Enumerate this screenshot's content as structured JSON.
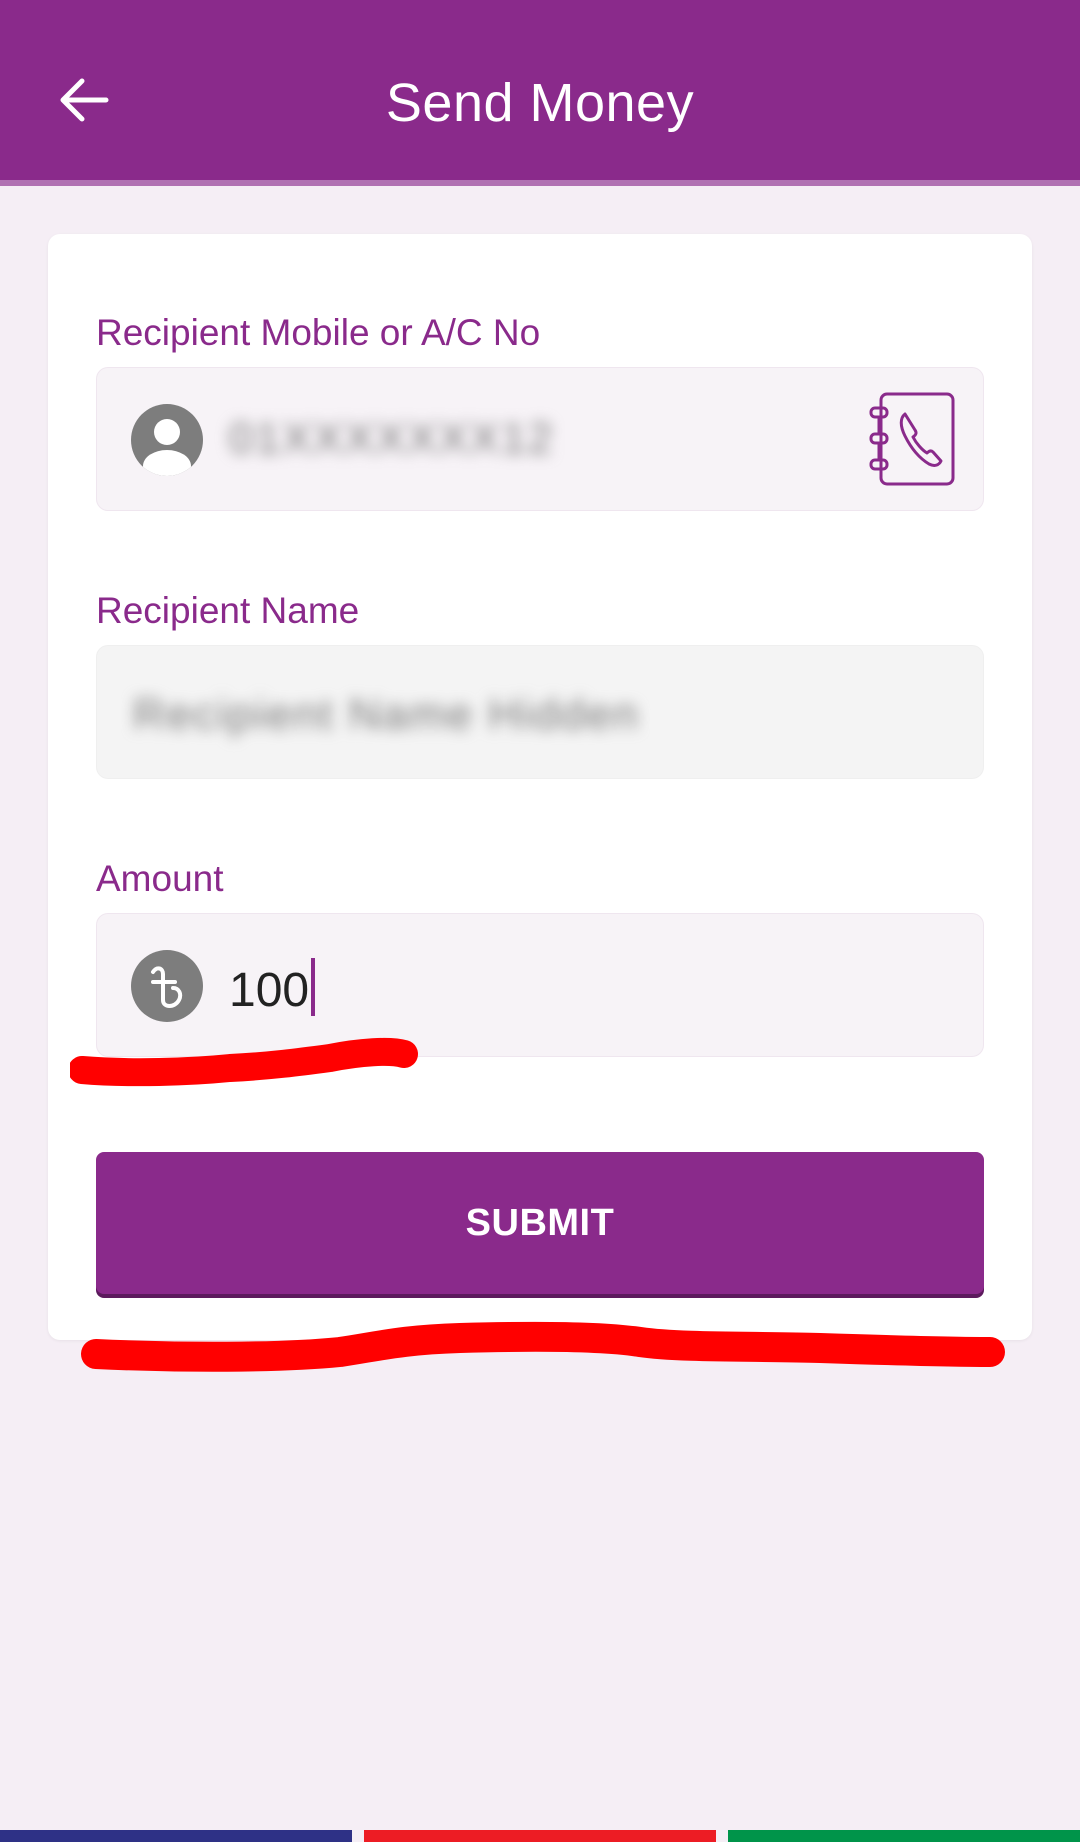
{
  "header": {
    "title": "Send Money",
    "back_icon": "arrow-left-icon",
    "background": "#8a2a8b"
  },
  "form": {
    "recipient_number": {
      "label": "Recipient Mobile or A/C No",
      "value_blurred": "01XXXXXXX12",
      "left_icon": "person-avatar-icon",
      "right_icon": "contacts-book-phone-icon"
    },
    "recipient_name": {
      "label": "Recipient Name",
      "value_blurred": "Recipient Name Hidden"
    },
    "amount": {
      "label": "Amount",
      "value": "100",
      "currency_icon": "taka-icon"
    },
    "submit_label": "SUBMIT"
  },
  "colors": {
    "accent": "#8a2a8b",
    "background": "#f5eef5",
    "annotation": "#ff0000",
    "strip_blue": "#2e3186",
    "strip_red": "#ed1c24",
    "strip_green": "#00944a"
  }
}
